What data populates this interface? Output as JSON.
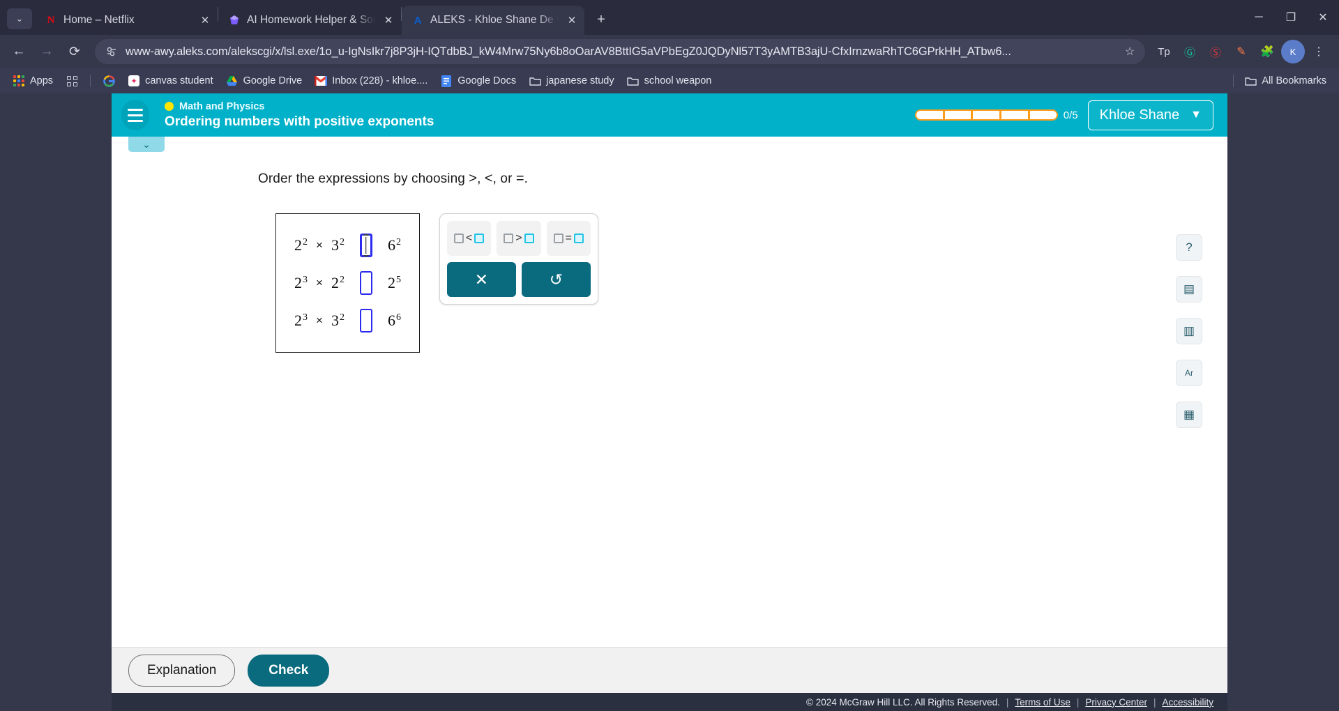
{
  "browser": {
    "tab_list_icon": "chevron-down-icon",
    "tabs": [
      {
        "title": "Home – Netflix",
        "favicon": "netflix-icon",
        "active": false
      },
      {
        "title": "AI Homework Helper & Solver -",
        "favicon": "gauth-icon",
        "active": false
      },
      {
        "title": "ALEKS - Khloe Shane De Castro",
        "favicon": "aleks-icon",
        "active": true
      }
    ],
    "new_tab_label": "+",
    "window_controls": {
      "minimize": "–",
      "maximize": "❐",
      "close": "✕"
    },
    "nav": {
      "back": "←",
      "forward": "→",
      "reload": "⟳"
    },
    "omnibox": {
      "site_icon": "page-info-icon",
      "url": "www-awy.aleks.com/alekscgi/x/lsl.exe/1o_u-IgNsIkr7j8P3jH-IQTdbBJ_kW4Mrw75Ny6b8oOarAV8BttIG5aVPbEgZ0JQDyNl57T3yAMTB3ajU-CfxIrnzwaRhTC6GPrkHH_ATbw6...",
      "bookmark_star": "☆"
    },
    "extensions": [
      "Tp",
      "G",
      "S",
      "pen-icon",
      "puzzle-icon",
      "profile-icon",
      "menu-icon"
    ],
    "bookmarks": {
      "apps_label": "Apps",
      "items": [
        {
          "label": "",
          "icon": "grid-icon"
        },
        {
          "label": "",
          "icon": "google-icon"
        },
        {
          "label": "canvas student",
          "icon": "canvas-icon"
        },
        {
          "label": "Google Drive",
          "icon": "drive-icon"
        },
        {
          "label": "Inbox (228) - khloe....",
          "icon": "gmail-icon"
        },
        {
          "label": "Google Docs",
          "icon": "docs-icon"
        },
        {
          "label": "japanese study",
          "icon": "folder-icon"
        },
        {
          "label": "school weapon",
          "icon": "folder-icon"
        }
      ],
      "all_bookmarks_label": "All Bookmarks"
    }
  },
  "aleks": {
    "menu_icon": "hamburger-icon",
    "course_label": "Math and Physics",
    "topic_title": "Ordering numbers with positive exponents",
    "progress": {
      "text": "0/5",
      "segments": 5,
      "filled": 0
    },
    "user_name": "Khloe Shane",
    "user_chevron": "chevron-down-icon",
    "panel_toggle_icon": "chevron-down-icon"
  },
  "problem": {
    "prompt_prefix": "Order the expressions by choosing",
    "prompt_ops": [
      ">",
      "<",
      "="
    ],
    "prompt_joiner_1": ",",
    "prompt_joiner_2": ", or",
    "prompt_end": ".",
    "rows": [
      {
        "left": {
          "base": "2",
          "exp": "2"
        },
        "operator_symbol": "×",
        "middle": {
          "base": "3",
          "exp": "2"
        },
        "answer": "",
        "right": {
          "base": "6",
          "exp": "2"
        },
        "focused": true
      },
      {
        "left": {
          "base": "2",
          "exp": "3"
        },
        "operator_symbol": "×",
        "middle": {
          "base": "2",
          "exp": "2"
        },
        "answer": "",
        "right": {
          "base": "2",
          "exp": "5"
        },
        "focused": false
      },
      {
        "left": {
          "base": "2",
          "exp": "3"
        },
        "operator_symbol": "×",
        "middle": {
          "base": "3",
          "exp": "2"
        },
        "answer": "",
        "right": {
          "base": "6",
          "exp": "6"
        },
        "focused": false
      }
    ]
  },
  "keypad": {
    "operators": [
      {
        "name": "less-than",
        "symbol": "<"
      },
      {
        "name": "greater-than",
        "symbol": ">"
      },
      {
        "name": "equals",
        "symbol": "="
      }
    ],
    "actions": [
      {
        "name": "clear",
        "glyph": "✕"
      },
      {
        "name": "undo",
        "glyph": "↺"
      }
    ]
  },
  "sidetools": [
    {
      "name": "help",
      "glyph": "?"
    },
    {
      "name": "calculator",
      "glyph": "▤"
    },
    {
      "name": "chart",
      "glyph": "▥"
    },
    {
      "name": "periodic-table",
      "glyph": "Ar"
    },
    {
      "name": "reference",
      "glyph": "▦"
    }
  ],
  "footer": {
    "explanation_label": "Explanation",
    "check_label": "Check"
  },
  "copyright": {
    "text": "© 2024 McGraw Hill LLC. All Rights Reserved.",
    "links": [
      "Terms of Use",
      "Privacy Center",
      "Accessibility"
    ],
    "separator": "|"
  }
}
